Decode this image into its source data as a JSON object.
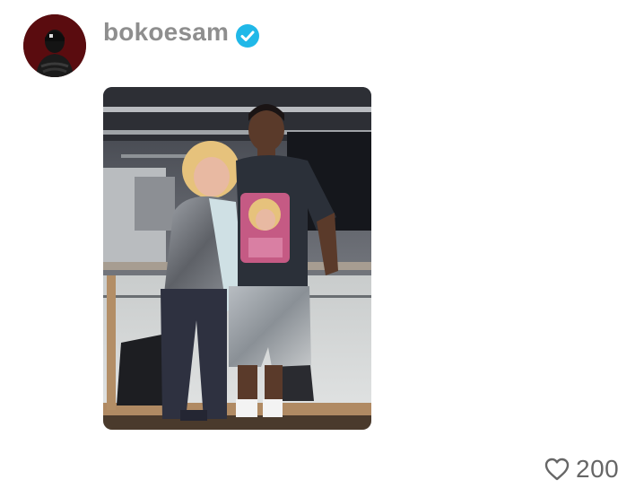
{
  "post": {
    "username": "bokoesam",
    "verified": true,
    "like_count": "200"
  },
  "icons": {
    "verified": "verified-badge-icon",
    "like": "heart-outline-icon"
  },
  "colors": {
    "username": "#8e8e8e",
    "verified_badge": "#20b8e8",
    "like_count": "#666666"
  }
}
